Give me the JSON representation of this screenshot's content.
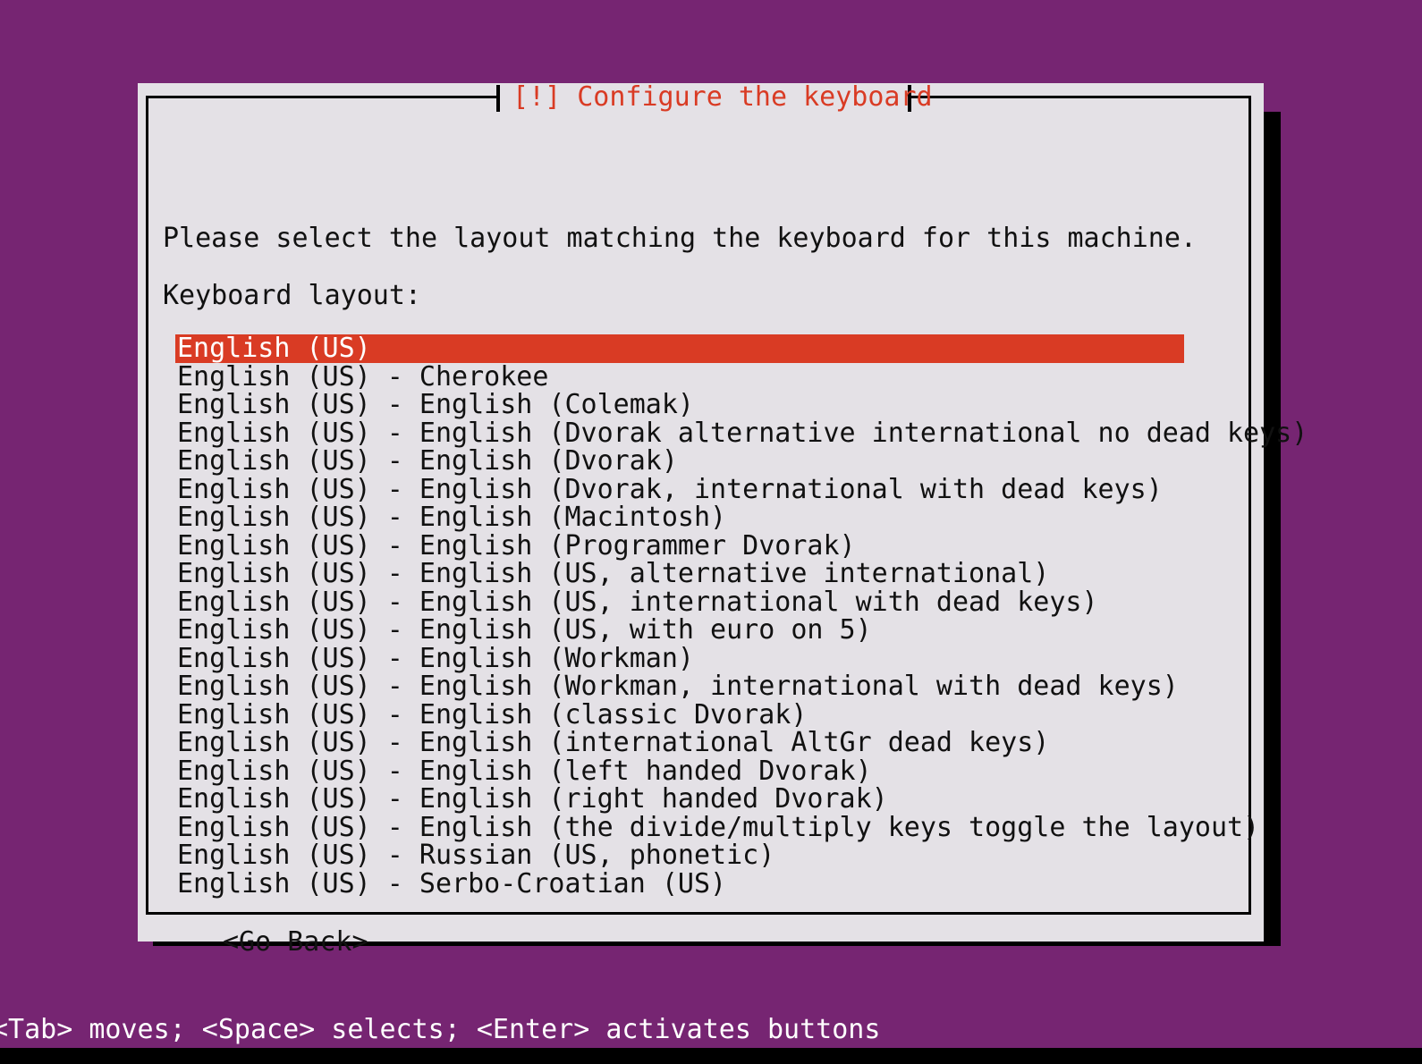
{
  "colors": {
    "desktop_background": "#762572",
    "dialog_background": "#e4e1e6",
    "dialog_border": "#000000",
    "title_accent": "#d93b24",
    "selection_background": "#d93b24",
    "selection_text": "#ffffff",
    "body_text": "#111111",
    "status_text": "#ffffff"
  },
  "dialog": {
    "title": "[!] Configure the keyboard",
    "prompt": "Please select the layout matching the keyboard for this machine.",
    "field_label": "Keyboard layout:",
    "selected_index": 0,
    "layouts": [
      "English (US)",
      "English (US) - Cherokee",
      "English (US) - English (Colemak)",
      "English (US) - English (Dvorak alternative international no dead keys)",
      "English (US) - English (Dvorak)",
      "English (US) - English (Dvorak, international with dead keys)",
      "English (US) - English (Macintosh)",
      "English (US) - English (Programmer Dvorak)",
      "English (US) - English (US, alternative international)",
      "English (US) - English (US, international with dead keys)",
      "English (US) - English (US, with euro on 5)",
      "English (US) - English (Workman)",
      "English (US) - English (Workman, international with dead keys)",
      "English (US) - English (classic Dvorak)",
      "English (US) - English (international AltGr dead keys)",
      "English (US) - English (left handed Dvorak)",
      "English (US) - English (right handed Dvorak)",
      "English (US) - English (the divide/multiply keys toggle the layout)",
      "English (US) - Russian (US, phonetic)",
      "English (US) - Serbo-Croatian (US)"
    ],
    "buttons": [
      "<Go Back>"
    ]
  },
  "status_bar": {
    "text": "<Tab> moves; <Space> selects; <Enter> activates buttons"
  }
}
